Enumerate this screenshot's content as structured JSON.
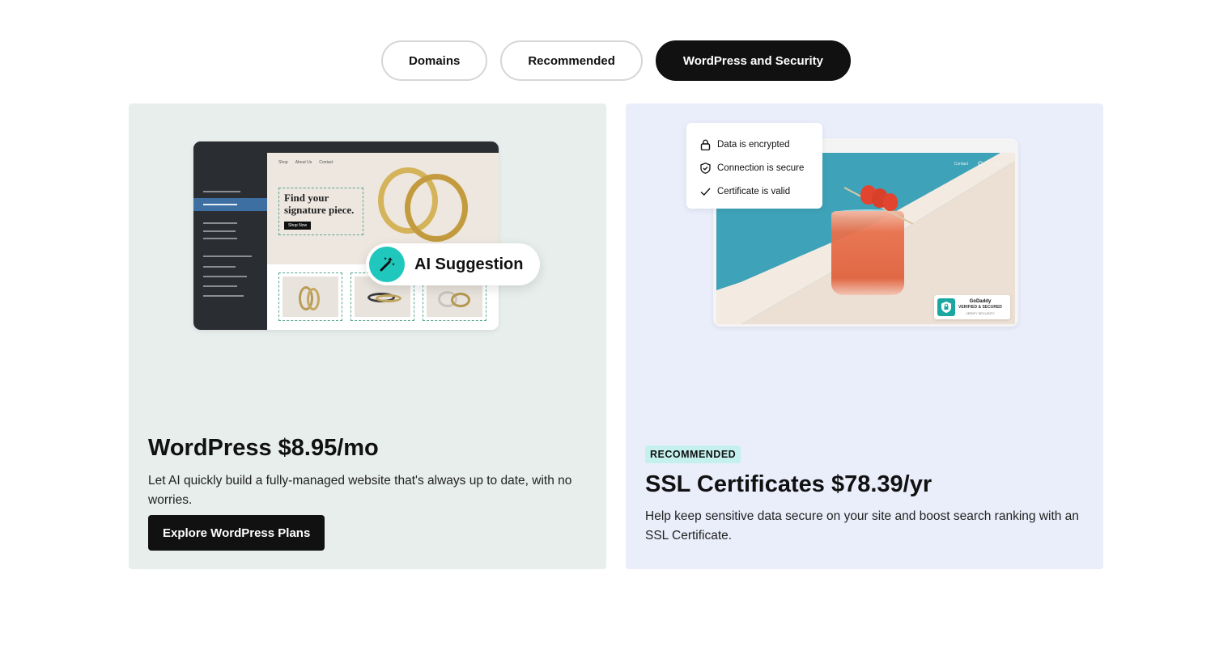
{
  "tabs": [
    {
      "label": "Domains",
      "active": false
    },
    {
      "label": "Recommended",
      "active": false
    },
    {
      "label": "WordPress and Security",
      "active": true
    }
  ],
  "wordpress_card": {
    "title": "WordPress $8.95/mo",
    "description": "Let AI quickly build a fully-managed website that's always up to date, with no worries.",
    "cta_label": "Explore WordPress Plans",
    "mockup": {
      "nav_items": [
        "Shop",
        "About Us",
        "Contact"
      ],
      "headline": "Find your signature piece.",
      "shop_button": "Shop Now",
      "ai_label": "AI Suggestion",
      "ai_icon": "magic-wand-icon"
    },
    "background_color": "#e7eeec"
  },
  "ssl_card": {
    "badge": "RECOMMENDED",
    "title": "SSL Certificates $78.39/yr",
    "description": "Help keep sensitive data secure on your site and boost search ranking with an SSL Certificate.",
    "checks": [
      {
        "icon": "lock-icon",
        "label": "Data is encrypted"
      },
      {
        "icon": "shield-check-icon",
        "label": "Connection is secure"
      },
      {
        "icon": "checkmark-icon",
        "label": "Certificate is valid"
      }
    ],
    "mockup": {
      "nav_item": "Contact",
      "seal_brand": "GoDaddy",
      "seal_status": "VERIFIED & SECURED",
      "seal_link": "VERIFY SECURITY"
    },
    "background_color": "#eaeefb",
    "badge_color": "#c4f1ee"
  },
  "colors": {
    "active_tab": "#111111",
    "cta": "#111111",
    "accent_teal": "#1fc7bd"
  }
}
